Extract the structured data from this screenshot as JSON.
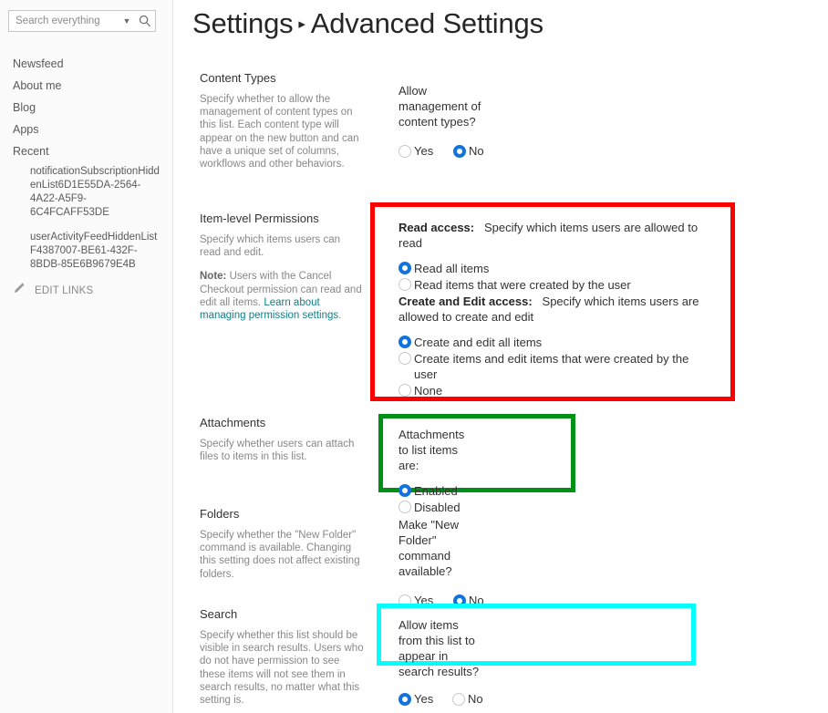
{
  "sidebar": {
    "search": {
      "placeholder": "Search everything",
      "chevron_icon": "chevron-down-icon",
      "search_icon": "magnifier-icon"
    },
    "items": [
      {
        "label": "Newsfeed"
      },
      {
        "label": "About me"
      },
      {
        "label": "Blog"
      },
      {
        "label": "Apps"
      },
      {
        "label": "Recent"
      }
    ],
    "recent_children": [
      {
        "label": "notificationSubscriptionHiddenList6D1E55DA-2564-4A22-A5F9-6C4FCAFF53DE"
      },
      {
        "label": "userActivityFeedHiddenListF4387007-BE61-432F-8BDB-85E6B9679E4B"
      }
    ],
    "edit_links": {
      "label": "EDIT LINKS",
      "icon": "pencil-icon"
    }
  },
  "header": {
    "breadcrumb_parent": "Settings",
    "separator": "▸",
    "title": "Advanced Settings"
  },
  "sections": {
    "content_types": {
      "title": "Content Types",
      "description": "Specify whether to allow the management of content types on this list. Each content type will appear on the new button and can have a unique set of columns, workflows and other behaviors.",
      "question": "Allow management of content types?",
      "options": [
        {
          "label": "Yes",
          "selected": false
        },
        {
          "label": "No",
          "selected": true
        }
      ]
    },
    "item_level_permissions": {
      "title": "Item-level Permissions",
      "description": "Specify which items users can read and edit.",
      "note_label": "Note:",
      "note_text": " Users with the Cancel Checkout permission can read and edit all items. ",
      "note_link": "Learn about managing permission settings",
      "note_link_suffix": ".",
      "read_access_label": "Read access:",
      "read_access_text": "Specify which items users are allowed to read",
      "read_options": [
        {
          "label": "Read all items",
          "selected": true
        },
        {
          "label": "Read items that were created by the user",
          "selected": false
        }
      ],
      "create_edit_label": "Create and Edit access:",
      "create_edit_text": "Specify which items users are allowed to create and edit",
      "create_options": [
        {
          "label": "Create and edit all items",
          "selected": true
        },
        {
          "label": "Create items and edit items that were created by the user",
          "selected": false
        },
        {
          "label": "None",
          "selected": false
        }
      ],
      "highlight_color": "#ff0000"
    },
    "attachments": {
      "title": "Attachments",
      "description": "Specify whether users can attach files to items in this list.",
      "question": "Attachments to list items are:",
      "options": [
        {
          "label": "Enabled",
          "selected": true
        },
        {
          "label": "Disabled",
          "selected": false
        }
      ],
      "highlight_color": "#009017"
    },
    "folders": {
      "title": "Folders",
      "description": "Specify whether the \"New Folder\" command is available. Changing this setting does not affect existing folders.",
      "question": "Make \"New Folder\" command available?",
      "options": [
        {
          "label": "Yes",
          "selected": false
        },
        {
          "label": "No",
          "selected": true
        }
      ]
    },
    "search": {
      "title": "Search",
      "description": "Specify whether this list should be visible in search results. Users who do not have permission to see these items will not see them in search results, no matter what this setting is.",
      "question": "Allow items from this list to appear in search results?",
      "options": [
        {
          "label": "Yes",
          "selected": true
        },
        {
          "label": "No",
          "selected": false
        }
      ],
      "highlight_color": "#00ffff"
    }
  }
}
